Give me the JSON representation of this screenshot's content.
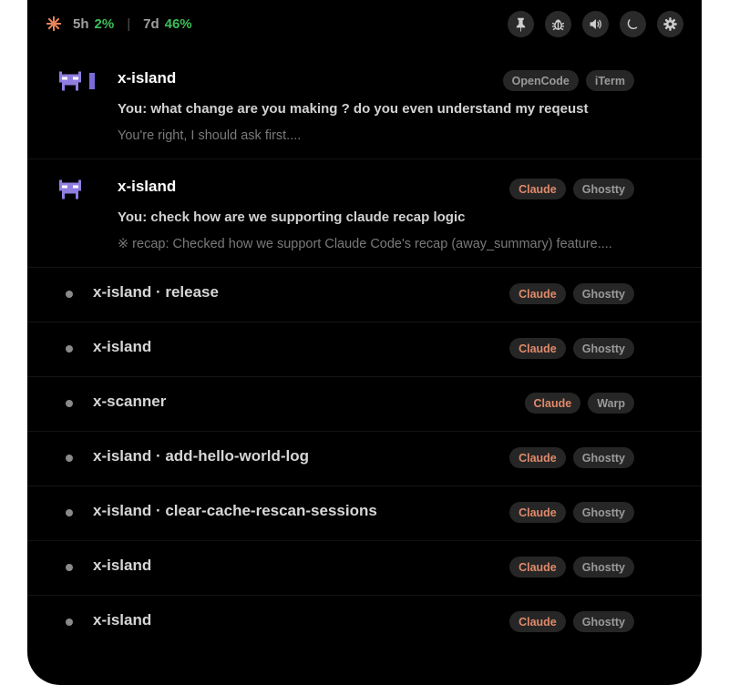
{
  "usage": {
    "session_label": "5h",
    "session_pct": "2%",
    "separator": "|",
    "week_label": "7d",
    "week_pct": "46%"
  },
  "toolbar": {
    "icons": [
      "pin-icon",
      "bug-icon",
      "speaker-icon",
      "moon-icon",
      "gear-icon"
    ]
  },
  "colors": {
    "accent_green": "#3cbf58",
    "claude_tag": "#e0896a",
    "spark_orange": "#e8845c",
    "avatar_purple": "#8f7de0"
  },
  "sessions_rich": [
    {
      "title": "x-island",
      "message": "You: what change are you making ? do you even understand my reqeust",
      "summary": "You're right, I should ask first....",
      "tags": [
        "OpenCode",
        "iTerm"
      ]
    },
    {
      "title": "x-island",
      "message": "You: check how are we supporting claude recap logic",
      "summary": "※ recap: Checked how we support Claude Code's recap (away_summary) feature....",
      "tags": [
        "Claude",
        "Ghostty"
      ]
    }
  ],
  "sessions": [
    {
      "title": "x-island · release",
      "tags": [
        "Claude",
        "Ghostty"
      ]
    },
    {
      "title": "x-island",
      "tags": [
        "Claude",
        "Ghostty"
      ]
    },
    {
      "title": "x-scanner",
      "tags": [
        "Claude",
        "Warp"
      ]
    },
    {
      "title": "x-island · add-hello-world-log",
      "tags": [
        "Claude",
        "Ghostty"
      ]
    },
    {
      "title": "x-island · clear-cache-rescan-sessions",
      "tags": [
        "Claude",
        "Ghostty"
      ]
    },
    {
      "title": "x-island",
      "tags": [
        "Claude",
        "Ghostty"
      ]
    },
    {
      "title": "x-island",
      "tags": [
        "Claude",
        "Ghostty"
      ]
    }
  ]
}
